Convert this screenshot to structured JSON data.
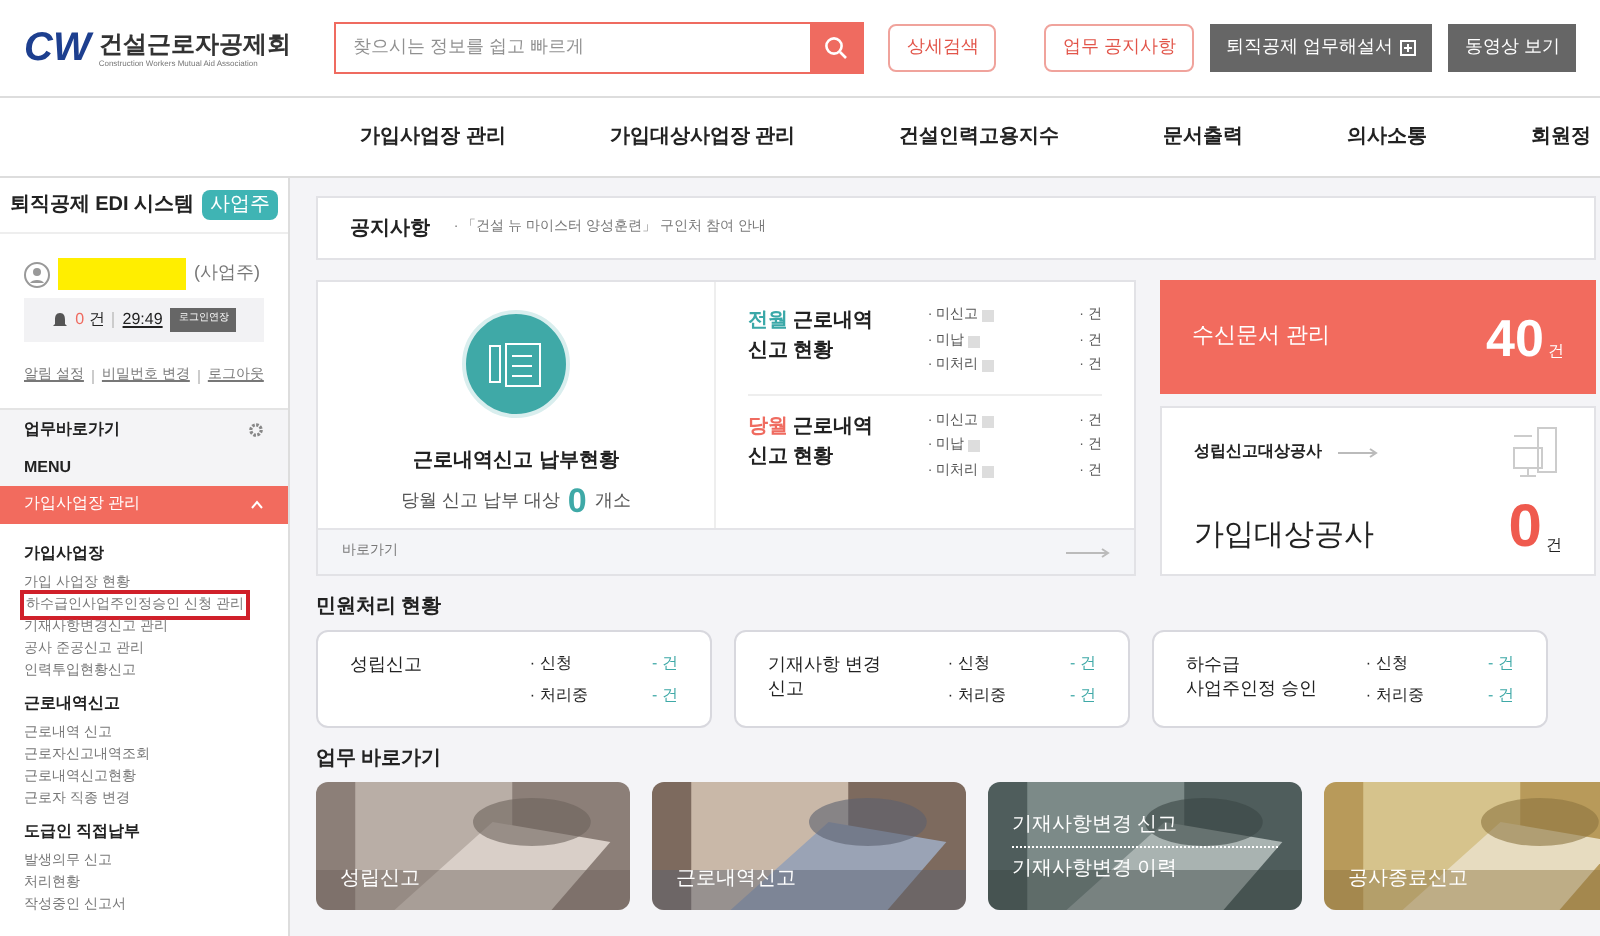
{
  "header": {
    "logo_mark": "CW",
    "logo_title": "건설근로자공제회",
    "logo_subtitle": "Construction Workers Mutual Aid Association",
    "search": {
      "placeholder": "찾으시는 정보를 쉽고 빠르게"
    },
    "buttons": [
      {
        "label": "상세검색",
        "kind": "outline"
      },
      {
        "label": "업무 공지사항",
        "kind": "outline"
      },
      {
        "label": "퇴직공제 업무해설서",
        "kind": "dark"
      },
      {
        "label": "동영상 보기",
        "kind": "dark"
      }
    ]
  },
  "nav": [
    "가입사업장 관리",
    "가입대상사업장 관리",
    "건설인력고용지수",
    "문서출력",
    "의사소통",
    "회원정"
  ],
  "sidebar": {
    "system": "퇴직공제 EDI 시스템",
    "role_badge": "사업주",
    "user_role": "(사업주)",
    "alerts": "0",
    "alerts_unit": "건",
    "timer": "29:49",
    "extend_button": "로그인연장",
    "links": [
      "알림 설정",
      "비밀번호 변경",
      "로그아웃"
    ],
    "shortcuts": "업무바로가기",
    "menu_label": "MENU",
    "active_menu": {
      "label": "가입사업장 관리",
      "expanded": true
    },
    "groups": [
      {
        "title": "가입사업장",
        "items": [
          {
            "label": "가입 사업장 현황",
            "highlighted": false
          },
          {
            "label": "하수급인사업주인정승인 신청 관리",
            "highlighted": true
          },
          {
            "label": "기재사항변경신고 관리",
            "highlighted": false
          },
          {
            "label": "공사 준공신고 관리",
            "highlighted": false
          },
          {
            "label": "인력투입현황신고",
            "highlighted": false
          }
        ]
      },
      {
        "title": "근로내역신고",
        "items": [
          {
            "label": "근로내역 신고",
            "highlighted": false
          },
          {
            "label": "근로자신고내역조회",
            "highlighted": false
          },
          {
            "label": "근로내역신고현황",
            "highlighted": false
          },
          {
            "label": "근로자 직종 변경",
            "highlighted": false
          }
        ]
      },
      {
        "title": "도급인 직접납부",
        "items": [
          {
            "label": "발생의무 신고",
            "highlighted": false
          },
          {
            "label": "처리현황",
            "highlighted": false
          },
          {
            "label": "작성중인 신고서",
            "highlighted": false
          }
        ]
      }
    ]
  },
  "notice": {
    "title": "공지사항",
    "item": "· 「건설 뉴 마이스터 양성훈련」 구인처 참여 안내"
  },
  "status": {
    "title": "근로내역신고 납부현황",
    "line_before": "당월 신고 납부 대상",
    "count": "0",
    "line_after": "개소",
    "link": "바로가기",
    "periods": [
      {
        "period": "전월",
        "color": "#3aa8a8",
        "title_a": "근로내역",
        "title_b": "신고 현황",
        "rows": [
          {
            "label": "· 미신고",
            "value": "· 건"
          },
          {
            "label": "· 미납",
            "value": "· 건"
          },
          {
            "label": "· 미처리",
            "value": "· 건"
          }
        ]
      },
      {
        "period": "당월",
        "color": "#ef6b60",
        "title_a": "근로내역",
        "title_b": "신고 현황",
        "rows": [
          {
            "label": "· 미신고",
            "value": "· 건"
          },
          {
            "label": "· 미납",
            "value": "· 건"
          },
          {
            "label": "· 미처리",
            "value": "· 건"
          }
        ]
      }
    ]
  },
  "inbox": {
    "title": "수신문서 관리",
    "count": "40",
    "unit": "건"
  },
  "target": {
    "link": "성립신고대상공사",
    "title": "가입대상공사",
    "count": "0",
    "unit": "건"
  },
  "civil": {
    "title": "민원처리 현황",
    "boxes": [
      {
        "lines": [
          "성립신고"
        ],
        "rows": [
          {
            "label": "· 신청",
            "value": "- 건"
          },
          {
            "label": "· 처리중",
            "value": "- 건"
          }
        ]
      },
      {
        "lines": [
          "기재사항 변경",
          "신고"
        ],
        "rows": [
          {
            "label": "· 신청",
            "value": "- 건"
          },
          {
            "label": "· 처리중",
            "value": "- 건"
          }
        ]
      },
      {
        "lines": [
          "하수급",
          "사업주인정 승인"
        ],
        "rows": [
          {
            "label": "· 신청",
            "value": "- 건"
          },
          {
            "label": "· 처리중",
            "value": "- 건"
          }
        ]
      }
    ]
  },
  "quick": {
    "title": "업무 바로가기",
    "tiles": [
      {
        "labels": [
          "성립신고"
        ],
        "kind": "picture"
      },
      {
        "labels": [
          "근로내역신고"
        ],
        "kind": "picture"
      },
      {
        "labels": [
          "기재사항변경 신고",
          "기재사항변경 이력"
        ],
        "kind": "picture"
      },
      {
        "labels": [
          "공사종료신고"
        ],
        "kind": "picture"
      }
    ]
  }
}
